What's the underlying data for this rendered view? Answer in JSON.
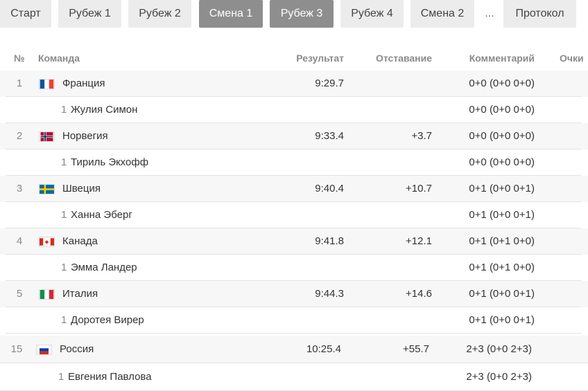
{
  "tabs": [
    {
      "label": "Старт",
      "active": false
    },
    {
      "label": "Рубеж 1",
      "active": false
    },
    {
      "label": "Рубеж 2",
      "active": false
    },
    {
      "label": "Смена 1",
      "active": true
    },
    {
      "label": "Рубеж 3",
      "active": true
    },
    {
      "label": "Рубеж 4",
      "active": false
    },
    {
      "label": "Смена 2",
      "active": false
    },
    {
      "label": "...",
      "active": false
    },
    {
      "label": "Протокол",
      "active": false
    }
  ],
  "table": {
    "headers": {
      "num": "№",
      "team": "Команда",
      "result": "Результат",
      "gap": "Отставание",
      "comment": "Комментарий",
      "points": "Очки"
    },
    "rows": [
      {
        "type": "team",
        "num": "1",
        "name": "Франция",
        "flag": "fr",
        "result": "9:29.7",
        "gap": "",
        "comment": "0+0 (0+0 0+0)"
      },
      {
        "type": "athlete",
        "num": "1",
        "name": "Жулия Симон",
        "comment": "0+0 (0+0 0+0)"
      },
      {
        "type": "team",
        "num": "2",
        "name": "Норвегия",
        "flag": "no",
        "result": "9:33.4",
        "gap": "+3.7",
        "comment": "0+0 (0+0 0+0)"
      },
      {
        "type": "athlete",
        "num": "1",
        "name": "Тириль Экхофф",
        "comment": "0+0 (0+0 0+0)"
      },
      {
        "type": "team",
        "num": "3",
        "name": "Швеция",
        "flag": "se",
        "result": "9:40.4",
        "gap": "+10.7",
        "comment": "0+1 (0+0 0+1)"
      },
      {
        "type": "athlete",
        "num": "1",
        "name": "Ханна Эберг",
        "comment": "0+1 (0+0 0+1)"
      },
      {
        "type": "team",
        "num": "4",
        "name": "Канада",
        "flag": "ca",
        "result": "9:41.8",
        "gap": "+12.1",
        "comment": "0+1 (0+1 0+0)"
      },
      {
        "type": "athlete",
        "num": "1",
        "name": "Эмма Ландер",
        "comment": "0+1 (0+1 0+0)"
      },
      {
        "type": "team",
        "num": "5",
        "name": "Италия",
        "flag": "it",
        "result": "9:44.3",
        "gap": "+14.6",
        "comment": "0+1 (0+0 0+1)"
      },
      {
        "type": "athlete",
        "num": "1",
        "name": "Доротея Вирер",
        "comment": "0+1 (0+0 0+1)"
      },
      {
        "type": "team",
        "num": "15",
        "name": "Россия",
        "flag": "ru",
        "result": "10:25.4",
        "gap": "+55.7",
        "comment": "2+3 (0+0 2+3)"
      },
      {
        "type": "athlete",
        "num": "1",
        "name": "Евгения Павлова",
        "comment": "2+3 (0+0 2+3)"
      }
    ]
  }
}
